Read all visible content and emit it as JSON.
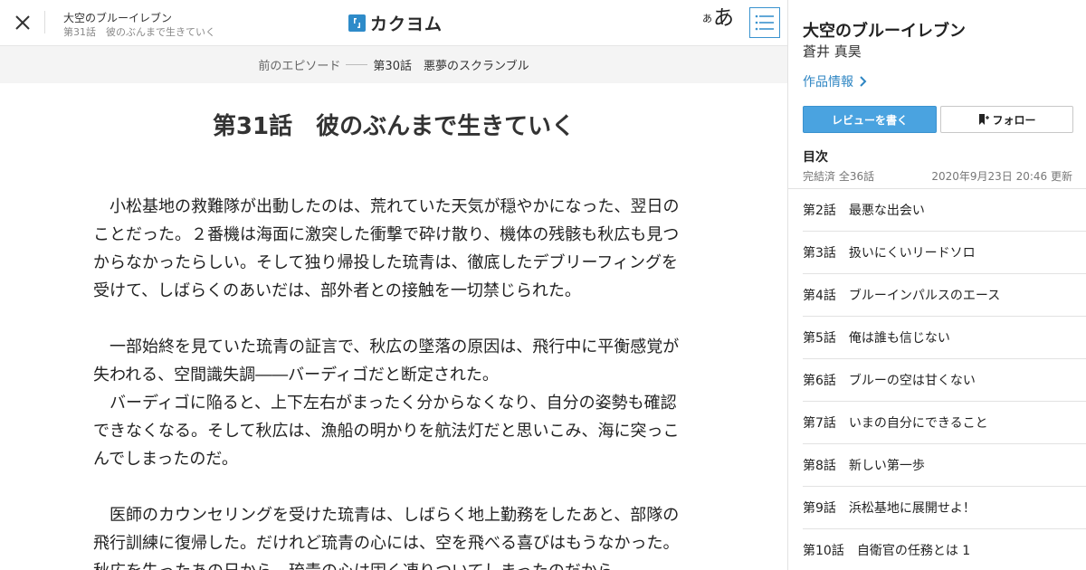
{
  "header": {
    "work_title": "大空のブルーイレブン",
    "episode_subtitle": "第31話　彼のぶんまで生きていく",
    "logo_text": "カクヨム",
    "font_size_small": "あ",
    "font_size_large": "あ"
  },
  "episode_nav": {
    "prev_label": "前のエピソード",
    "prev_title": "第30話　悪夢のスクランブル"
  },
  "main": {
    "title": "第31話　彼のぶんまで生きていく",
    "paragraphs": [
      "　小松基地の救難隊が出動したのは、荒れていた天気が穏やかになった、翌日のことだった。２番機は海面に激突した衝撃で砕け散り、機体の残骸も秋広も見つからなかったらしい。そして独り帰投した琉青は、徹底したデブリーフィングを受けて、しばらくのあいだは、部外者との接触を一切禁じられた。",
      "",
      "　一部始終を見ていた琉青の証言で、秋広の墜落の原因は、飛行中に平衡感覚が失われる、空間識失調――バーディゴだと断定された。",
      "　バーディゴに陥ると、上下左右がまったく分からなくなり、自分の姿勢も確認できなくなる。そして秋広は、漁船の明かりを航法灯だと思いこみ、海に突っこんでしまったのだ。",
      "",
      "　医師のカウンセリングを受けた琉青は、しばらく地上勤務をしたあと、部隊の飛行訓練に復帰した。だけれど琉青の心には、空を飛べる喜びはもうなかった。",
      "秋広を失ったあの日から、琉青の心は固く凍りついてしまったのだから。"
    ]
  },
  "sidebar": {
    "title": "大空のブルーイレブン",
    "author": "蒼井 真昊",
    "work_info": "作品情報",
    "review_button": "レビューを書く",
    "follow_button": "フォロー",
    "toc_heading": "目次",
    "toc_status": "完結済 全36話",
    "toc_updated": "2020年9月23日 20:46 更新",
    "toc_items": [
      "第2話　最悪な出会い",
      "第3話　扱いにくいリードソロ",
      "第4話　ブルーインパルスのエース",
      "第5話　俺は誰も信じない",
      "第6話　ブルーの空は甘くない",
      "第7話　いまの自分にできること",
      "第8話　新しい第一歩",
      "第9話　浜松基地に展開せよ！",
      "第10話　自衛官の任務とは 1"
    ]
  },
  "colors": {
    "accent": "#2f86c3",
    "review_button_bg": "#4aa3e0",
    "nav_bar_bg": "#f4f4f4"
  },
  "icons": {
    "close": "close-icon",
    "logo": "kakuyomu-logo-icon",
    "toc": "list-icon",
    "work_info_arrow": "chevron-right-icon",
    "follow": "bookmark-plus-icon"
  }
}
